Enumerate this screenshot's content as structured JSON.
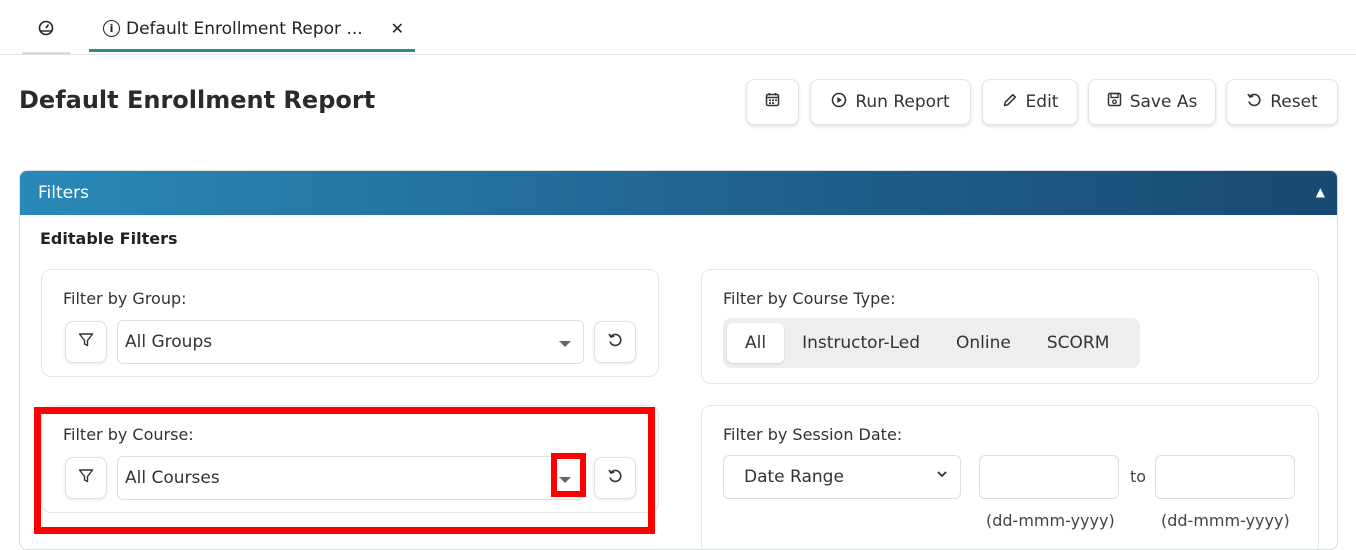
{
  "tabs": {
    "home_icon": "dashboard-icon",
    "active_label": "Default Enrollment Repor ...",
    "active_icon": "info-icon",
    "close_symbol": "✕"
  },
  "page": {
    "title": "Default Enrollment Report"
  },
  "toolbar": {
    "schedule_icon": "calendar-icon",
    "run_label": "Run Report",
    "edit_label": "Edit",
    "save_as_label": "Save As",
    "reset_label": "Reset"
  },
  "filters": {
    "header": "Filters",
    "section": "Editable Filters",
    "group": {
      "label": "Filter by Group:",
      "value": "All Groups"
    },
    "course": {
      "label": "Filter by Course:",
      "value": "All Courses"
    },
    "course_type": {
      "label": "Filter by Course Type:",
      "options": [
        "All",
        "Instructor-Led",
        "Online",
        "SCORM"
      ],
      "selected": "All"
    },
    "session_date": {
      "label": "Filter by Session Date:",
      "mode": "Date Range",
      "from_value": "",
      "to_value": "",
      "separator": "to",
      "format_hint": "(dd-mmm-yyyy)"
    }
  },
  "colors": {
    "accent": "#2f8c86",
    "header_start": "#2a89b8",
    "header_end": "#174a73",
    "highlight": "#ff0000"
  }
}
